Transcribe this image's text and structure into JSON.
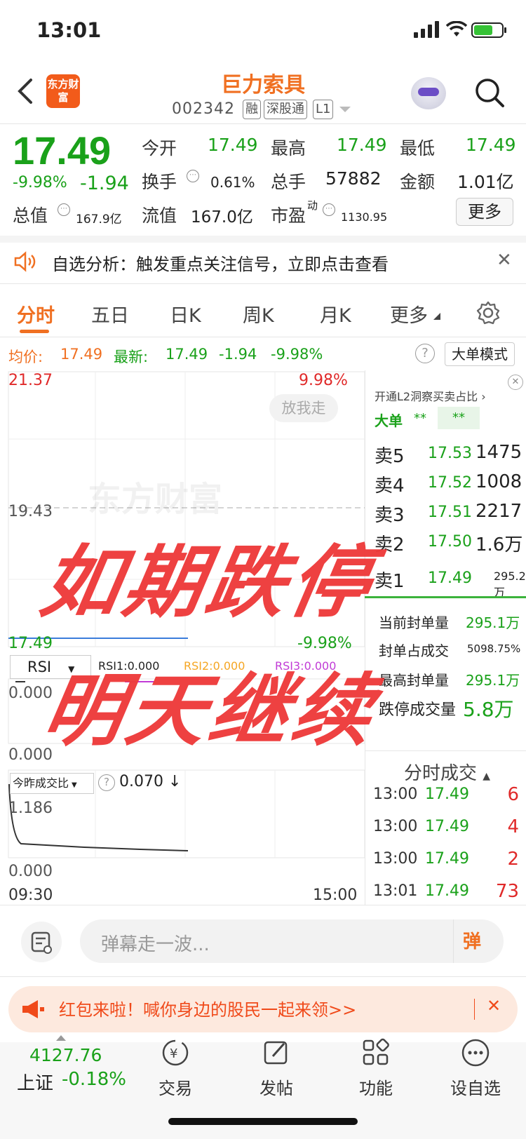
{
  "status": {
    "time": "13:01"
  },
  "header": {
    "logo_text": "东方财富",
    "name": "巨力索具",
    "code": "002342",
    "tags": [
      "融",
      "深股通",
      "L1"
    ]
  },
  "quote": {
    "price": "17.49",
    "change_pct": "-9.98%",
    "change": "-1.94",
    "open_label": "今开",
    "open": "17.49",
    "high_label": "最高",
    "high": "17.49",
    "low_label": "最低",
    "low": "17.49",
    "turnover_label": "换手",
    "turnover": "0.61%",
    "volume_label": "总手",
    "volume": "57882",
    "amount_label": "金额",
    "amount": "1.01亿",
    "mktcap_label": "总值",
    "mktcap": "167.9亿",
    "float_label": "流值",
    "float": "167.0亿",
    "pe_label": "市盈",
    "pe_sup": "动",
    "pe": "1130.95",
    "more": "更多"
  },
  "notice": {
    "text": "自选分析：触发重点关注信号，立即点击查看"
  },
  "tabs": [
    "分时",
    "五日",
    "日K",
    "周K",
    "月K",
    "更多"
  ],
  "avg_row": {
    "avg_label": "均价:",
    "avg": "17.49",
    "latest_label": "最新:",
    "latest": "17.49",
    "chg": "-1.94",
    "pct": "-9.98%",
    "big_mode": "大单模式"
  },
  "chart": {
    "y_top": "21.37",
    "y_mid": "19.43",
    "y_bot": "17.49",
    "pct_top": "9.98%",
    "pct_bot": "-9.98%",
    "watermark": "东方财富",
    "let_go": "放我走",
    "rsi_select": "RSI",
    "rsi1": "RSI1:0.000",
    "rsi2": "RSI2:0.000",
    "rsi3": "RSI3:0.000",
    "rsi_top": "0.000",
    "rsi_bot": "0.000",
    "ratio_select": "今昨成交比",
    "ratio_val": "0.070",
    "ratio_top": "1.186",
    "ratio_bot": "0.000",
    "time_start": "09:30",
    "time_end": "15:00"
  },
  "chart_data": {
    "type": "line",
    "x": [
      "09:30",
      "15:00"
    ],
    "series": [
      {
        "values": [
          17.49,
          17.49
        ]
      }
    ],
    "ylim": [
      17.49,
      21.37
    ]
  },
  "panel": {
    "l2_link": "开通L2洞察买卖占比",
    "big_order": "大单",
    "big_v1": "**",
    "big_v2": "**",
    "asks": [
      {
        "label": "卖5",
        "price": "17.53",
        "vol": "1475"
      },
      {
        "label": "卖4",
        "price": "17.52",
        "vol": "1008"
      },
      {
        "label": "卖3",
        "price": "17.51",
        "vol": "2217"
      },
      {
        "label": "卖2",
        "price": "17.50",
        "vol": "1.6万"
      }
    ],
    "ask1_vol": "295.2万",
    "seal_label": "当前封单量",
    "seal": "295.1万",
    "seal_ratio_label": "封单占成交",
    "seal_ratio": "5098.75%",
    "max_seal_label": "最高封单量",
    "max_seal": "295.1万",
    "limit_vol_label": "跌停成交量",
    "limit_vol": "5.8万",
    "ticks_title": "分时成交",
    "ticks": [
      {
        "time": "13:00",
        "price": "17.49",
        "vol": "6"
      },
      {
        "time": "13:00",
        "price": "17.49",
        "vol": "4"
      },
      {
        "time": "13:00",
        "price": "17.49",
        "vol": "2"
      },
      {
        "time": "13:01",
        "price": "17.49",
        "vol": "73"
      }
    ]
  },
  "overlay": {
    "line1": "如期跌停",
    "line2": "明天继续"
  },
  "comment": {
    "placeholder": "弹幕走一波...",
    "button": "弹"
  },
  "banner": {
    "text": "红包来啦！喊你身边的股民一起来领>>"
  },
  "nav": {
    "index_value": "4127.76",
    "index_name": "上证",
    "index_pct": "-0.18%",
    "items": [
      "交易",
      "发帖",
      "功能",
      "设自选"
    ]
  }
}
